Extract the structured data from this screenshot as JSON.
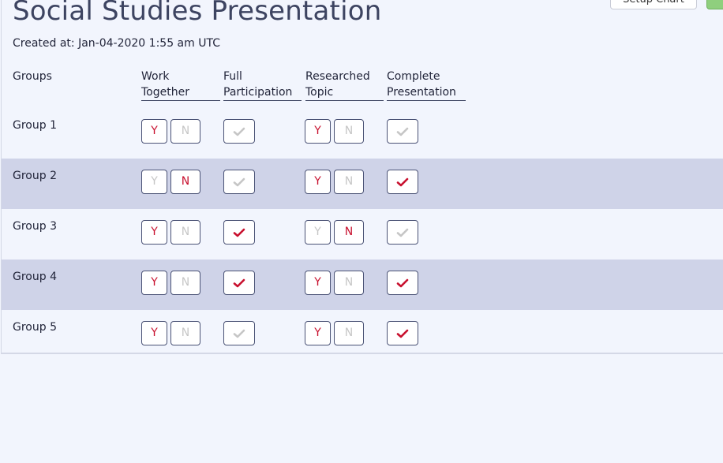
{
  "page": {
    "title": "Social Studies Presentation",
    "created": "Created at: Jan-04-2020 1:55 am UTC"
  },
  "toolbar": {
    "setup_chart_label": "Setup Chart"
  },
  "colors": {
    "selected": "#c8102e",
    "unselected": "#c6c6c6",
    "row_alt_bg": "#cfd3e8",
    "page_bg": "#f2f5fd"
  },
  "table": {
    "headers": {
      "groups": "Groups",
      "work_together_1": "Work",
      "work_together_2": "Together",
      "full_participation_1": "Full",
      "full_participation_2": "Participation",
      "researched_topic_1": "Researched",
      "researched_topic_2": "Topic",
      "complete_presentation_1": "Complete",
      "complete_presentation_2": "Presentation"
    },
    "yes_label": "Y",
    "no_label": "N",
    "rows": [
      {
        "name": "Group 1",
        "work_together": "Y",
        "full_participation": false,
        "researched_topic": "Y",
        "complete_presentation": false
      },
      {
        "name": "Group 2",
        "work_together": "N",
        "full_participation": false,
        "researched_topic": "Y",
        "complete_presentation": true
      },
      {
        "name": "Group 3",
        "work_together": "Y",
        "full_participation": true,
        "researched_topic": "N",
        "complete_presentation": false
      },
      {
        "name": "Group 4",
        "work_together": "Y",
        "full_participation": true,
        "researched_topic": "Y",
        "complete_presentation": true
      },
      {
        "name": "Group 5",
        "work_together": "Y",
        "full_participation": false,
        "researched_topic": "Y",
        "complete_presentation": true
      }
    ]
  }
}
